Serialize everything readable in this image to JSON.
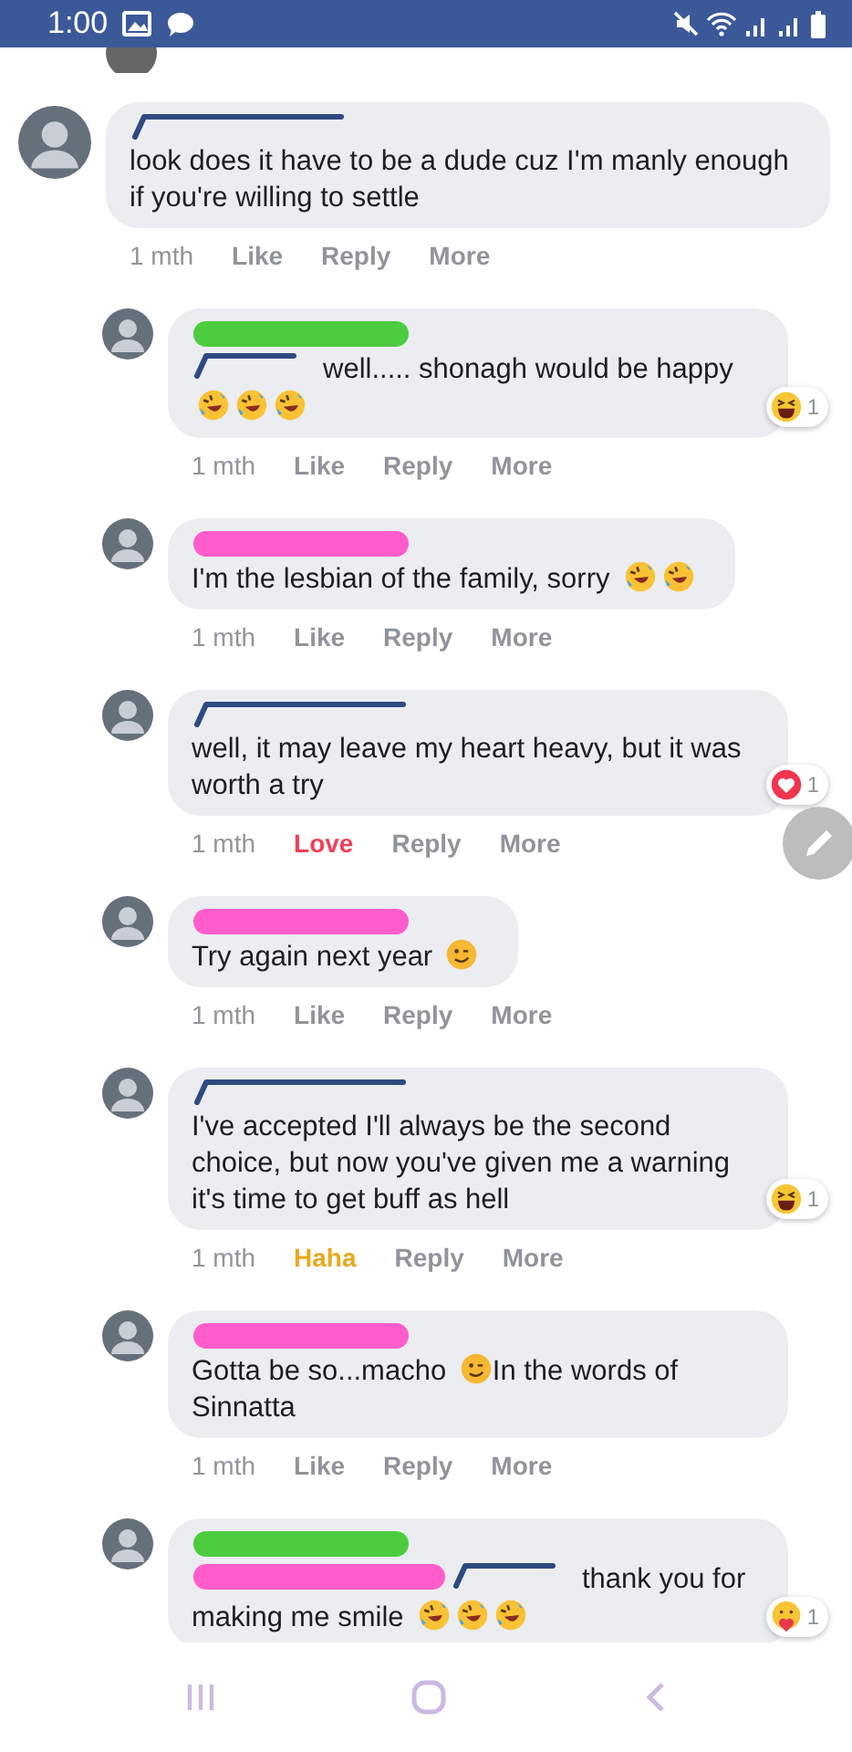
{
  "status_bar": {
    "time": "1:00"
  },
  "comments": [
    {
      "reply": false,
      "name_marks": [
        {
          "kind": "scribble",
          "color": "#2e4a80"
        }
      ],
      "parts": [
        {
          "kind": "text",
          "text": "look does it have to be a dude cuz I'm manly enough if you're willing to settle"
        }
      ],
      "time": "1 mth",
      "react": {
        "label": "Like",
        "kind": "none"
      },
      "reply_label": "Reply",
      "more": "More"
    },
    {
      "reply": true,
      "name_marks": [
        {
          "kind": "marker",
          "color": "#4ccc3f"
        }
      ],
      "parts": [
        {
          "kind": "redaction",
          "color": "#2e4a80"
        },
        {
          "kind": "text",
          "text": "well..... shonagh would be happy"
        },
        {
          "kind": "rofl"
        },
        {
          "kind": "rofl"
        },
        {
          "kind": "rofl"
        }
      ],
      "reaction": {
        "kind": "haha",
        "count": "1"
      },
      "time": "1 mth",
      "react": {
        "label": "Like",
        "kind": "none"
      },
      "reply_label": "Reply",
      "more": "More"
    },
    {
      "reply": true,
      "name_marks": [
        {
          "kind": "marker",
          "color": "#ff5dcc"
        }
      ],
      "parts": [
        {
          "kind": "text",
          "text": "I'm the lesbian of the family, sorry"
        },
        {
          "kind": "rofl"
        },
        {
          "kind": "rofl"
        }
      ],
      "time": "1 mth",
      "react": {
        "label": "Like",
        "kind": "none"
      },
      "reply_label": "Reply",
      "more": "More"
    },
    {
      "reply": true,
      "name_marks": [
        {
          "kind": "scribble",
          "color": "#2e4a80"
        }
      ],
      "parts": [
        {
          "kind": "text",
          "text": "well, it may leave my heart heavy, but it was worth a try"
        }
      ],
      "reaction": {
        "kind": "love",
        "count": "1"
      },
      "time": "1 mth",
      "react": {
        "label": "Love",
        "kind": "love"
      },
      "reply_label": "Reply",
      "more": "More"
    },
    {
      "reply": true,
      "name_marks": [
        {
          "kind": "marker",
          "color": "#ff5dcc"
        }
      ],
      "parts": [
        {
          "kind": "text",
          "text": "Try again next year"
        },
        {
          "kind": "wink"
        }
      ],
      "time": "1 mth",
      "react": {
        "label": "Like",
        "kind": "none"
      },
      "reply_label": "Reply",
      "more": "More"
    },
    {
      "reply": true,
      "name_marks": [
        {
          "kind": "scribble",
          "color": "#2e4a80"
        }
      ],
      "parts": [
        {
          "kind": "text",
          "text": "I've accepted I'll always be the second choice, but now you've given me a warning it's time to get buff as hell"
        }
      ],
      "reaction": {
        "kind": "haha",
        "count": "1"
      },
      "time": "1 mth",
      "react": {
        "label": "Haha",
        "kind": "haha"
      },
      "reply_label": "Reply",
      "more": "More"
    },
    {
      "reply": true,
      "name_marks": [
        {
          "kind": "marker",
          "color": "#ff5dcc"
        }
      ],
      "parts": [
        {
          "kind": "text",
          "text": "Gotta be so...macho"
        },
        {
          "kind": "wink"
        },
        {
          "kind": "text",
          "text": "In the words of"
        },
        {
          "kind": "text",
          "text": "Sinnatta"
        }
      ],
      "time": "1 mth",
      "react": {
        "label": "Like",
        "kind": "none"
      },
      "reply_label": "Reply",
      "more": "More"
    },
    {
      "reply": true,
      "name_marks": [
        {
          "kind": "marker",
          "color": "#4ccc3f"
        }
      ],
      "parts": [
        {
          "kind": "redaction",
          "color": "#ff5dcc"
        },
        {
          "kind": "redaction",
          "color": "#2e4a80"
        },
        {
          "kind": "text",
          "text": "thank you for"
        },
        {
          "kind": "text",
          "text": "making me smile"
        },
        {
          "kind": "rofl"
        },
        {
          "kind": "rofl"
        },
        {
          "kind": "rofl"
        }
      ],
      "reaction": {
        "kind": "care",
        "count": "1"
      }
    }
  ]
}
